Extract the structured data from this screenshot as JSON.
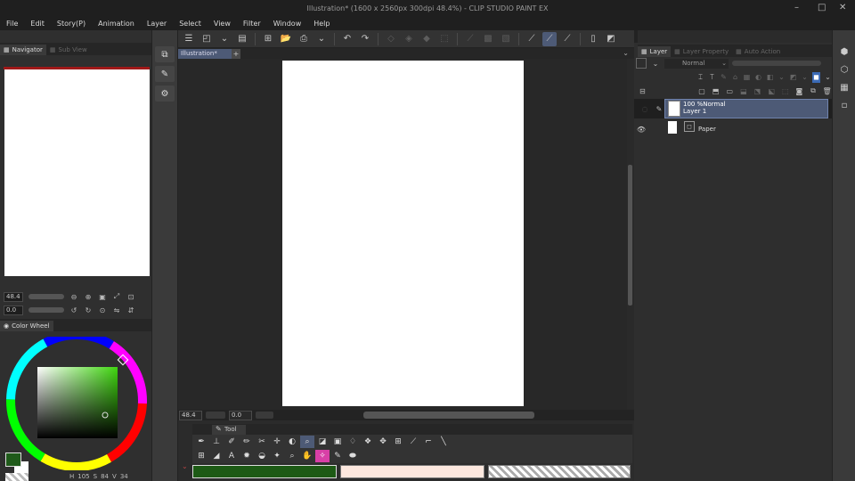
{
  "window": {
    "title": "Illustration* (1600 x 2560px 300dpi 48.4%) - CLIP STUDIO PAINT EX",
    "controls": [
      "–",
      "□",
      "✕"
    ]
  },
  "menu": [
    "File",
    "Edit",
    "Story(P)",
    "Animation",
    "Layer",
    "Select",
    "View",
    "Filter",
    "Window",
    "Help"
  ],
  "navigator": {
    "tabs": [
      "Navigator",
      "Sub View"
    ],
    "zoom": "48.4",
    "rotation": "0.0"
  },
  "color_panel": {
    "tab": "Color Wheel",
    "h": "105",
    "s": "84",
    "v": "34",
    "main_color": "#1f5a1a",
    "sub_color": "#ffffff"
  },
  "document": {
    "tab": "Illustration*",
    "plus": "+",
    "status_zoom": "48.4",
    "status_rot": "0.0"
  },
  "subtool": {
    "tab": "Tool"
  },
  "color_bars": {
    "main": "#1d5a15",
    "sub": "#fde8df"
  },
  "layer_panel": {
    "tabs": [
      "Layer",
      "Layer Property",
      "Auto Action"
    ],
    "blend_mode": "Normal",
    "layers": [
      {
        "opacity_mode": "100 %Normal",
        "name": "Layer 1",
        "selected": true
      },
      {
        "name": "Paper",
        "selected": false
      }
    ]
  },
  "colors": {
    "accent": "#4d5a76",
    "hover_blue": "#7083ad"
  }
}
